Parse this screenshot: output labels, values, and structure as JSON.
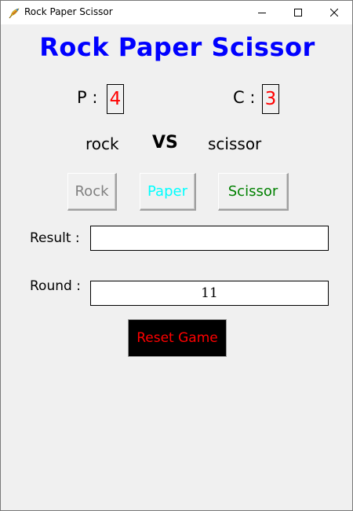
{
  "window": {
    "title": "Rock Paper Scissor"
  },
  "app": {
    "title": "Rock Paper Scissor"
  },
  "score": {
    "player_label": "P :",
    "player_value": "4",
    "computer_label": "C :",
    "computer_value": "3"
  },
  "choices": {
    "player": "rock",
    "vs": "VS",
    "computer": "scissor"
  },
  "buttons": {
    "rock": "Rock",
    "paper": "Paper",
    "scissor": "Scissor",
    "reset": "Reset Game"
  },
  "result": {
    "label": "Result :",
    "value": ""
  },
  "round": {
    "label": "Round :",
    "value": "11"
  },
  "colors": {
    "title": "#0000ff",
    "score_value": "#ff0000",
    "rock_button_text": "#808080",
    "paper_button_text": "#00ffff",
    "scissor_button_text": "#008000",
    "reset_button_bg": "#000000",
    "reset_button_text": "#ff0000",
    "window_bg": "#f0f0f0"
  },
  "icons": {
    "app": "feather-icon",
    "minimize": "minimize-icon",
    "maximize": "maximize-icon",
    "close": "close-icon"
  }
}
